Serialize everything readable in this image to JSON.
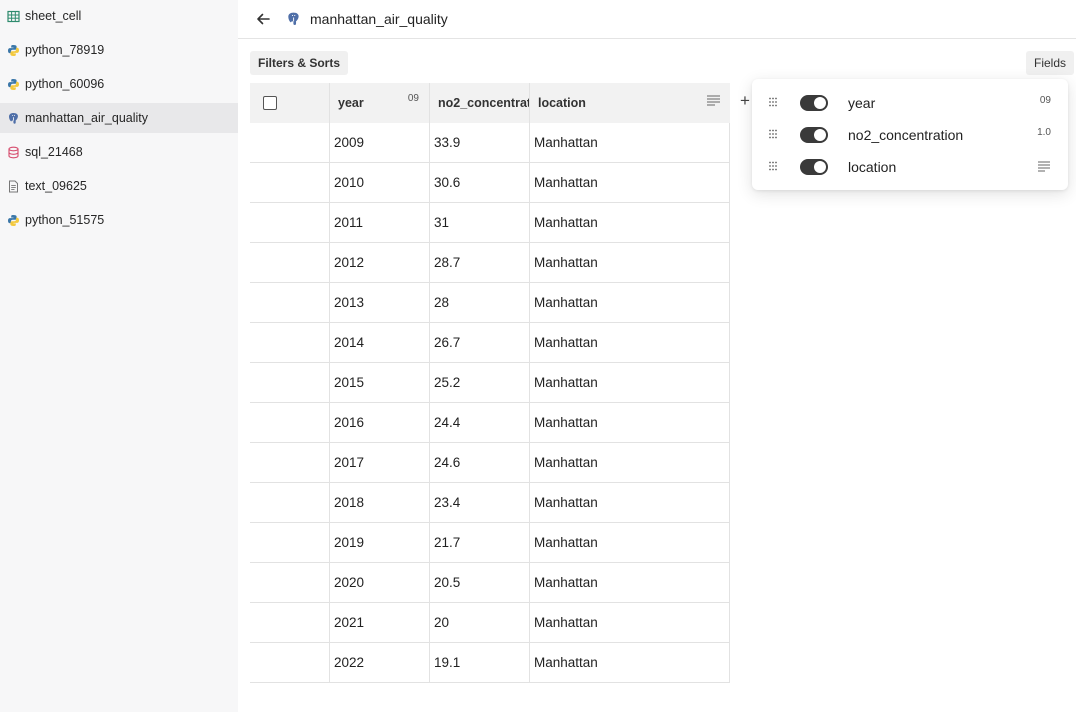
{
  "sidebar": {
    "items": [
      {
        "label": "sheet_cell",
        "icon": "sheet-icon"
      },
      {
        "label": "python_78919",
        "icon": "python-icon"
      },
      {
        "label": "python_60096",
        "icon": "python-icon"
      },
      {
        "label": "manhattan_air_quality",
        "icon": "postgres-icon",
        "active": true
      },
      {
        "label": "sql_21468",
        "icon": "database-icon"
      },
      {
        "label": "text_09625",
        "icon": "text-file-icon"
      },
      {
        "label": "python_51575",
        "icon": "python-icon"
      }
    ]
  },
  "header": {
    "title": "manhattan_air_quality"
  },
  "toolbar": {
    "filters_label": "Filters & Sorts",
    "fields_label": "Fields"
  },
  "table": {
    "columns": [
      {
        "name": "year",
        "type_badge": "09"
      },
      {
        "name": "no2_concentration",
        "type_badge": ""
      },
      {
        "name": "location",
        "type_badge": ""
      }
    ],
    "rows": [
      [
        "2009",
        "33.9",
        "Manhattan"
      ],
      [
        "2010",
        "30.6",
        "Manhattan"
      ],
      [
        "2011",
        "31",
        "Manhattan"
      ],
      [
        "2012",
        "28.7",
        "Manhattan"
      ],
      [
        "2013",
        "28",
        "Manhattan"
      ],
      [
        "2014",
        "26.7",
        "Manhattan"
      ],
      [
        "2015",
        "25.2",
        "Manhattan"
      ],
      [
        "2016",
        "24.4",
        "Manhattan"
      ],
      [
        "2017",
        "24.6",
        "Manhattan"
      ],
      [
        "2018",
        "23.4",
        "Manhattan"
      ],
      [
        "2019",
        "21.7",
        "Manhattan"
      ],
      [
        "2020",
        "20.5",
        "Manhattan"
      ],
      [
        "2021",
        "20",
        "Manhattan"
      ],
      [
        "2022",
        "19.1",
        "Manhattan"
      ]
    ]
  },
  "fields_panel": {
    "fields": [
      {
        "name": "year",
        "enabled": true,
        "type_badge": "09"
      },
      {
        "name": "no2_concentration",
        "enabled": true,
        "type_badge": "1.0"
      },
      {
        "name": "location",
        "enabled": true,
        "type_badge": ""
      }
    ]
  },
  "colors": {
    "accent_dark": "#3a3a3a",
    "sidebar_bg": "#f7f7f8",
    "active_item_bg": "#e8e8ea"
  }
}
